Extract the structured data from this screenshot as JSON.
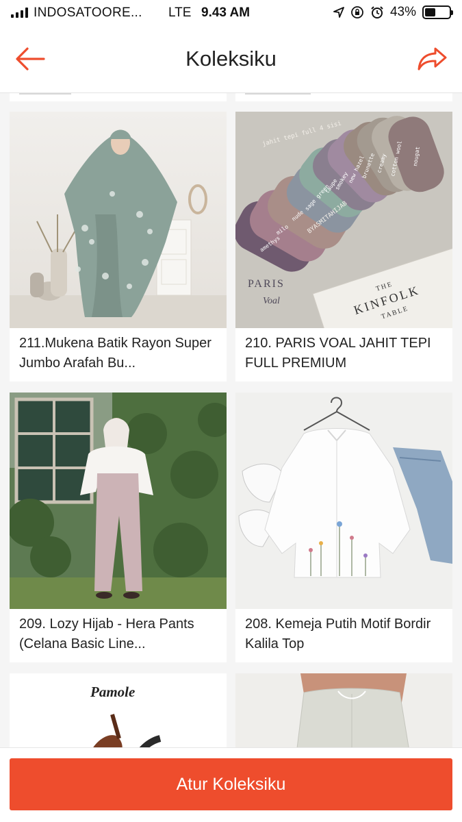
{
  "status_bar": {
    "carrier": "INDOSATOORE...",
    "network": "LTE",
    "time": "9.43 AM",
    "battery": "43%",
    "battery_level": 0.43
  },
  "header": {
    "title": "Koleksiku",
    "back_icon": "arrow-left-icon",
    "share_icon": "share-arrow-icon",
    "accent_color": "#ee4d2d"
  },
  "products": [
    {
      "title": "211.Mukena Batik Rayon Super Jumbo Arafah Bu..."
    },
    {
      "title": "210. PARIS VOAL JAHIT TEPI FULL PREMIUM"
    },
    {
      "title": "209. Lozy Hijab - Hera Pants (Celana Basic Line..."
    },
    {
      "title": "208. Kemeja Putih Motif Bordir Kalila Top"
    }
  ],
  "image_text": {
    "scarf_labels": [
      "amethys",
      "milo",
      "nude",
      "sage green",
      "taupe",
      "smokey",
      "new hazel",
      "brunette",
      "creamy",
      "cotton wool",
      "nougat"
    ],
    "scarf_header": "jahit tepi full 4 sisi",
    "scarf_brand": "BYASMITAHIJAB",
    "scarf_caption_top": "PARIS",
    "scarf_caption_script": "Voal",
    "book_line1": "THE",
    "book_line2": "KINFOLK",
    "book_line3": "TABLE",
    "next_logo": "Pamole"
  },
  "bottom": {
    "button_label": "Atur Koleksiku",
    "button_color": "#ee4d2d"
  }
}
